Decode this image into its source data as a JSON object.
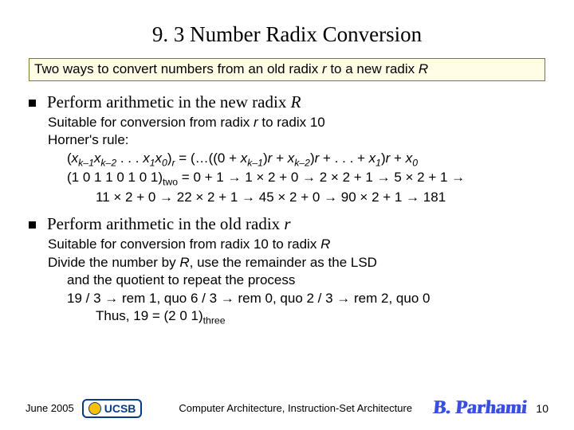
{
  "title": "9. 3  Number Radix Conversion",
  "intro": {
    "pre": "Two ways to convert numbers from an old radix ",
    "r": "r",
    "mid": " to a new radix ",
    "R": "R"
  },
  "bullet1": {
    "pre": "Perform arithmetic in the new radix ",
    "R": "R"
  },
  "block1": {
    "l1a": "Suitable for conversion from radix ",
    "l1r": "r",
    "l1b": " to radix 10",
    "l2": "Horner's rule:",
    "l3_lp": "(",
    "l3_x": "x",
    "l3_k1": "k–1",
    "l3_k2": "k–2",
    "l3_dots": " . . . ",
    "l3_s1": "1",
    "l3_s0": "0",
    "l3_rp": ")",
    "l3_rsub": "r",
    "l3_eq": "  =  (…((0 + ",
    "l3_rpar": ")",
    "l3_r": "r",
    "l3_plus": " + ",
    "l3_tail": " + . . . + ",
    "l3_sx1": "1",
    "l3_sx0": "0",
    "l4a": "(1 0 1 1 0 1 0 1)",
    "l4two": "two",
    "l4b": " = 0 + 1 ",
    "l4c": " 1 × 2 + 0 ",
    "l4d": " 2 × 2 + 1 ",
    "l4e": " 5 × 2 + 1 ",
    "l5a": "11 × 2 + 0 ",
    "l5b": " 22 × 2 + 1 ",
    "l5c": " 45 × 2 + 0 ",
    "l5d": " 90 × 2 + 1 ",
    "l5e": " 181"
  },
  "bullet2": {
    "pre": "Perform arithmetic in the old radix ",
    "r": "r"
  },
  "block2": {
    "l1a": "Suitable for conversion from radix 10 to radix ",
    "l1R": "R",
    "l2a": "Divide the number by ",
    "l2R": "R",
    "l2b": ", use the remainder as the LSD",
    "l3": "and the quotient to repeat the process",
    "l4a": "19 / 3  ",
    "l4b": "  rem 1, quo 6 / 3  ",
    "l4c": "  rem 0, quo 2 / 3  ",
    "l4d": "  rem 2, quo 0",
    "l5a": "Thus, 19 = (2 0 1)",
    "l5three": "three"
  },
  "footer": {
    "date": "June 2005",
    "logo": "UCSB",
    "mid": "Computer Architecture, Instruction-Set Architecture",
    "sig": "B. Parhami",
    "page": "10"
  },
  "glyph": {
    "arrow": "→",
    "times": "×"
  }
}
